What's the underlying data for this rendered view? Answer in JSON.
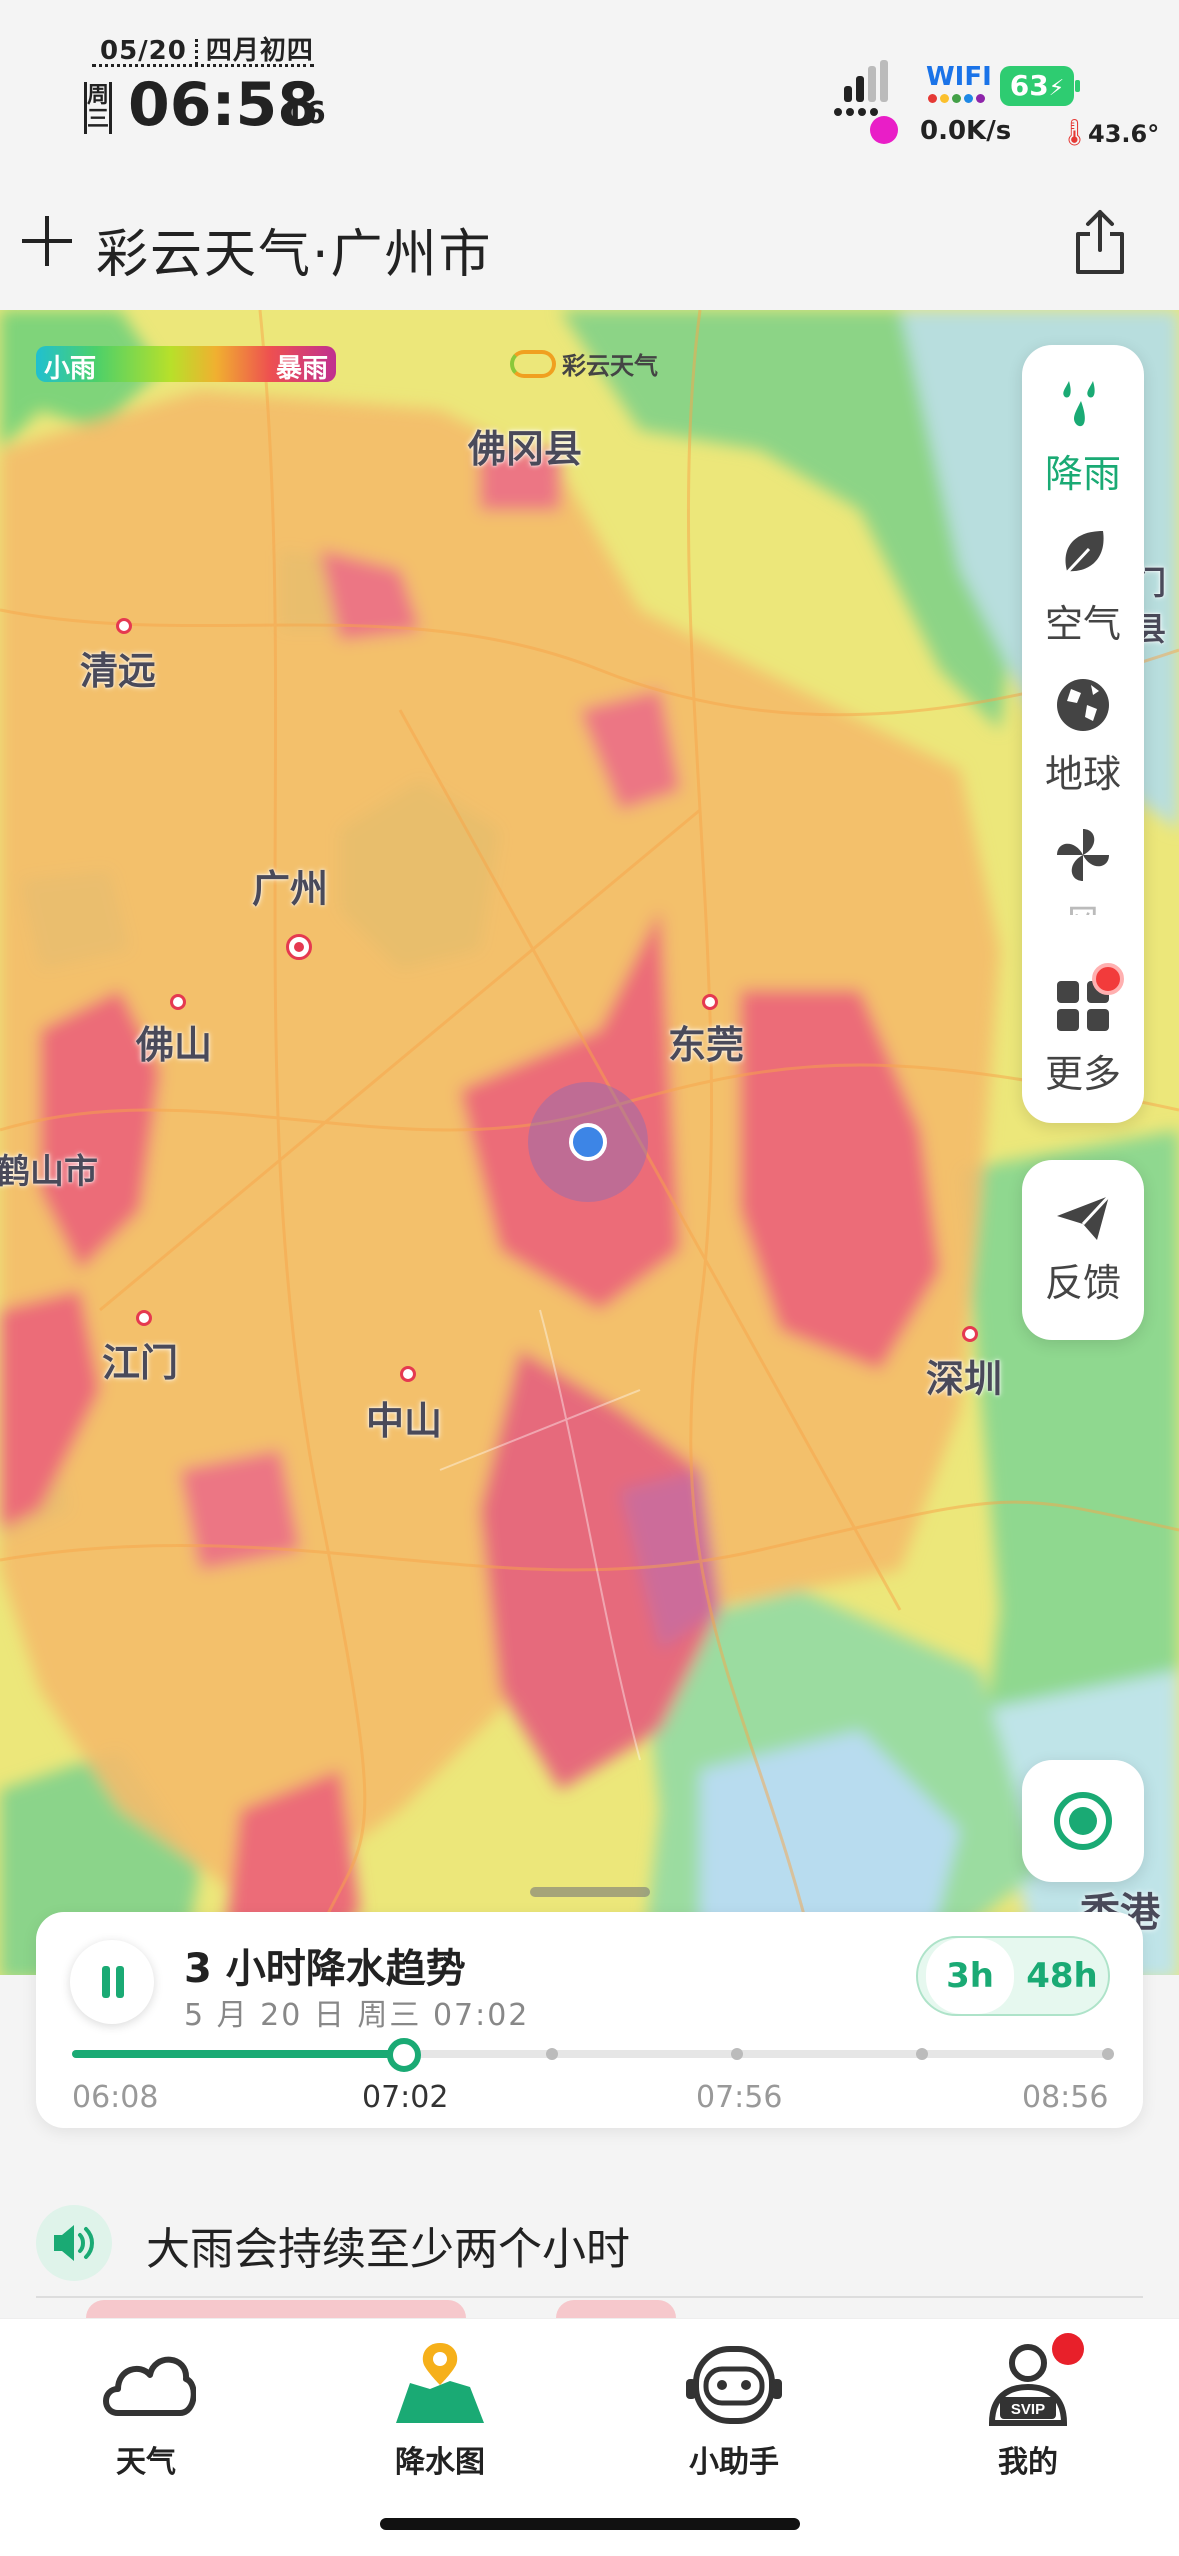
{
  "status_bar": {
    "date": "05/20",
    "lunar_date": "四月初四",
    "weekday": "周三",
    "time": "06:58",
    "seconds": "16",
    "wifi_label": "WIFI",
    "battery": "63",
    "net_speed": "0.0K/s",
    "temperature": "43.6°"
  },
  "header": {
    "title": "彩云天气·广州市"
  },
  "map": {
    "legend_low": "小雨",
    "legend_high": "暴雨",
    "watermark": "彩云天气",
    "cities": {
      "fogang": "佛冈县",
      "qingyuan": "清远",
      "guangzhou": "广州",
      "foshan": "佛山",
      "dongguan": "东莞",
      "heshan": "鹤山市",
      "jiangmen": "江门",
      "zhongshan": "中山",
      "shenzhen": "深圳",
      "hongkong": "香港",
      "edge_county": "门县"
    }
  },
  "layers": [
    {
      "label": "降雨",
      "icon": "rain-drops-icon",
      "active": true
    },
    {
      "label": "空气",
      "icon": "leaf-icon",
      "active": false
    },
    {
      "label": "地球",
      "icon": "globe-icon",
      "active": false
    },
    {
      "label": "风",
      "icon": "pinwheel-icon",
      "active": false
    },
    {
      "label": "更多",
      "icon": "grid-icon",
      "active": false
    }
  ],
  "feedback": {
    "label": "反馈"
  },
  "forecast_card": {
    "title": "3 小时降水趋势",
    "subtitle": "5 月 20 日 周三 07:02",
    "range_options": [
      "3h",
      "48h"
    ],
    "progress": 0.32,
    "ticks": [
      "06:08",
      "07:02",
      "07:56",
      "08:56"
    ]
  },
  "speech": {
    "text": "大雨会持续至少两个小时"
  },
  "tabs": [
    {
      "label": "天气",
      "icon": "cloud-icon"
    },
    {
      "label": "降水图",
      "icon": "rain-map-icon"
    },
    {
      "label": "小助手",
      "icon": "assistant-robot-icon"
    },
    {
      "label": "我的",
      "icon": "profile-svip-icon"
    }
  ],
  "colors": {
    "accent": "#1aaa74",
    "badge": "#f23b3b",
    "user_location": "#3d85e6"
  }
}
